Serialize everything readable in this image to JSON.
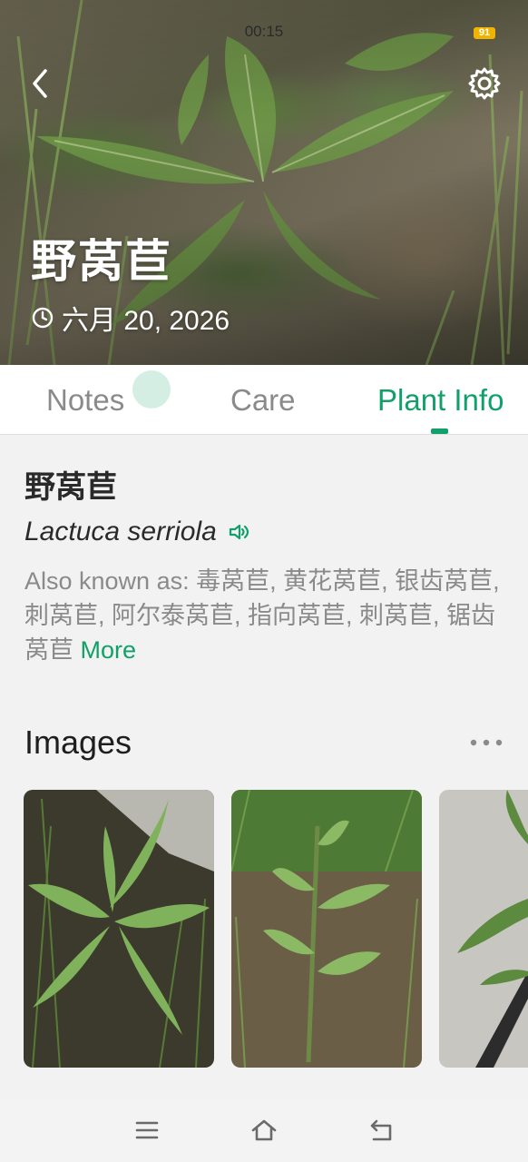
{
  "status_bar": {
    "time": "00:15",
    "battery": "91"
  },
  "header": {
    "title": "野莴苣",
    "date": "六月 20, 2026",
    "back_icon": "chevron-left-icon",
    "settings_icon": "gear-icon"
  },
  "tabs": [
    {
      "label": "Notes",
      "active": false
    },
    {
      "label": "Care",
      "active": false
    },
    {
      "label": "Plant Info",
      "active": true
    }
  ],
  "plant_info": {
    "common_name": "野莴苣",
    "scientific_name": "Lactuca serriola",
    "pronounce_icon": "speaker-icon",
    "also_known_as": "Also known as: 毒莴苣, 黄花莴苣, 银齿莴苣, 刺莴苣, 阿尔泰莴苣, 指向莴苣, 刺莴苣, 锯齿莴苣",
    "more_label": "More"
  },
  "images_section": {
    "heading": "Images",
    "more_icon": "more-horizontal-icon",
    "thumbnails": [
      "plant-photo-1",
      "plant-photo-2",
      "plant-photo-3"
    ]
  },
  "nav_bar": {
    "menu_icon": "menu-icon",
    "home_icon": "home-icon",
    "back_icon": "back-icon"
  },
  "colors": {
    "accent": "#12a06a",
    "text_primary": "#2a2a2a",
    "text_secondary": "#8a8a8a"
  }
}
